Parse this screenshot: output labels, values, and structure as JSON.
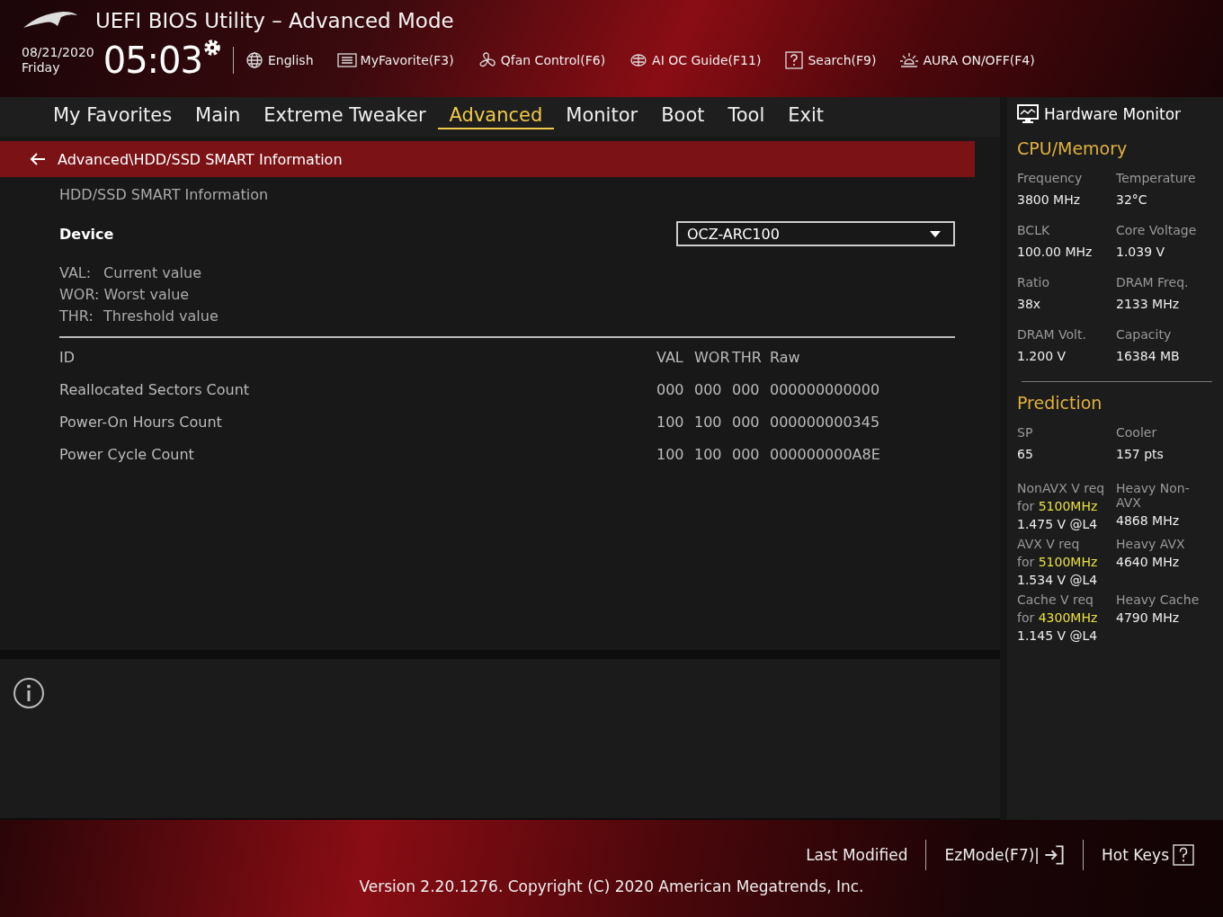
{
  "window": {
    "title": "UEFI BIOS Utility – Advanced Mode"
  },
  "clock": {
    "date": "08/21/2020",
    "weekday": "Friday",
    "time": "05:03"
  },
  "toolbar": [
    {
      "kind": "globe",
      "label": "English"
    },
    {
      "kind": "favorite",
      "label": "MyFavorite(F3)"
    },
    {
      "kind": "fan",
      "label": "Qfan Control(F6)"
    },
    {
      "kind": "chip",
      "label": "AI OC Guide(F11)"
    },
    {
      "kind": "help",
      "label": "Search(F9)"
    },
    {
      "kind": "aura",
      "label": "AURA ON/OFF(F4)"
    }
  ],
  "tabs": [
    {
      "label": "My Favorites",
      "selected": false
    },
    {
      "label": "Main",
      "selected": false
    },
    {
      "label": "Extreme Tweaker",
      "selected": false
    },
    {
      "label": "Advanced",
      "selected": true
    },
    {
      "label": "Monitor",
      "selected": false
    },
    {
      "label": "Boot",
      "selected": false
    },
    {
      "label": "Tool",
      "selected": false
    },
    {
      "label": "Exit",
      "selected": false
    }
  ],
  "breadcrumb": "Advanced\\HDD/SSD SMART Information",
  "section_title": "HDD/SSD SMART Information",
  "device": {
    "label": "Device",
    "value": "OCZ-ARC100"
  },
  "legend": [
    {
      "abbr": "VAL:",
      "text": "Current value"
    },
    {
      "abbr": "WOR:",
      "text": "Worst value"
    },
    {
      "abbr": "THR:",
      "text": "Threshold value"
    }
  ],
  "table": {
    "columns": [
      "ID",
      "VAL",
      "WOR",
      "THR",
      "Raw"
    ],
    "rows": [
      [
        "Reallocated Sectors Count",
        "000",
        "000",
        "000",
        "000000000000"
      ],
      [
        "Power-On Hours Count",
        "100",
        "100",
        "000",
        "000000000345"
      ],
      [
        "Power Cycle Count",
        "100",
        "100",
        "000",
        "000000000A8E"
      ]
    ]
  },
  "hardware_monitor": {
    "title": "Hardware Monitor",
    "cpu_memory": {
      "title": "CPU/Memory",
      "items": [
        {
          "label": "Frequency",
          "value": "3800 MHz"
        },
        {
          "label": "Temperature",
          "value": "32°C"
        },
        {
          "label": "BCLK",
          "value": "100.00 MHz"
        },
        {
          "label": "Core Voltage",
          "value": "1.039 V"
        },
        {
          "label": "Ratio",
          "value": "38x"
        },
        {
          "label": "DRAM Freq.",
          "value": "2133 MHz"
        },
        {
          "label": "DRAM Volt.",
          "value": "1.200 V"
        },
        {
          "label": "Capacity",
          "value": "16384 MB"
        }
      ]
    },
    "prediction": {
      "title": "Prediction",
      "items": [
        {
          "label": "SP",
          "value": "65"
        },
        {
          "label": "Cooler",
          "value": "157 pts"
        }
      ],
      "requirements": [
        {
          "label": "NonAVX V req",
          "prefix": "for",
          "frequency": "5100MHz",
          "value": "1.475 V @L4",
          "heavy_label": "Heavy Non-AVX",
          "heavy_value": "4868 MHz"
        },
        {
          "label": "AVX V req",
          "prefix": "for",
          "frequency": "5100MHz",
          "value": "1.534 V @L4",
          "heavy_label": "Heavy AVX",
          "heavy_value": "4640 MHz"
        },
        {
          "label": "Cache V req",
          "prefix": "for",
          "frequency": "4300MHz",
          "value": "1.145 V @L4",
          "heavy_label": "Heavy Cache",
          "heavy_value": "4790 MHz"
        }
      ]
    }
  },
  "footer": {
    "buttons": [
      {
        "kind": "plain",
        "label": "Last Modified"
      },
      {
        "kind": "exit",
        "label": "EzMode(F7)|"
      },
      {
        "kind": "help",
        "label": "Hot Keys"
      }
    ],
    "version": "Version 2.20.1276. Copyright (C) 2020 American Megatrends, Inc."
  }
}
